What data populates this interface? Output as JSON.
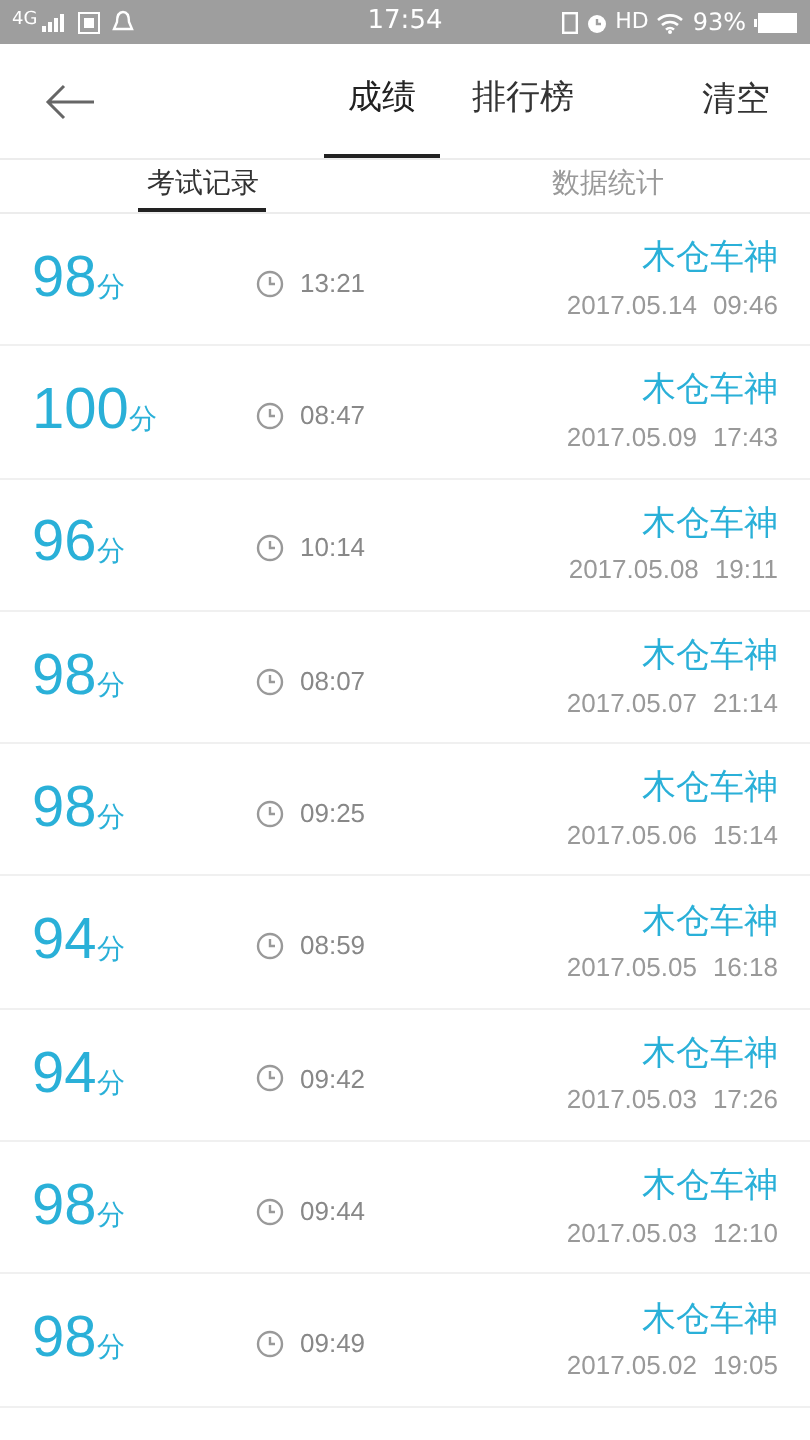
{
  "status_bar": {
    "network": "4G",
    "time": "17:54",
    "hd": "HD",
    "battery": "93%"
  },
  "header": {
    "tabs": [
      {
        "label": "成绩",
        "selected": true
      },
      {
        "label": "排行榜",
        "selected": false
      }
    ],
    "action": "清空"
  },
  "sub_tabs": [
    {
      "label": "考试记录",
      "selected": true
    },
    {
      "label": "数据统计",
      "selected": false
    }
  ],
  "records": [
    {
      "score": "98",
      "unit": "分",
      "duration": "13:21",
      "name": "木仓车神",
      "date": "2017.05.14",
      "time": "09:46"
    },
    {
      "score": "100",
      "unit": "分",
      "duration": "08:47",
      "name": "木仓车神",
      "date": "2017.05.09",
      "time": "17:43"
    },
    {
      "score": "96",
      "unit": "分",
      "duration": "10:14",
      "name": "木仓车神",
      "date": "2017.05.08",
      "time": "19:11"
    },
    {
      "score": "98",
      "unit": "分",
      "duration": "08:07",
      "name": "木仓车神",
      "date": "2017.05.07",
      "time": "21:14"
    },
    {
      "score": "98",
      "unit": "分",
      "duration": "09:25",
      "name": "木仓车神",
      "date": "2017.05.06",
      "time": "15:14"
    },
    {
      "score": "94",
      "unit": "分",
      "duration": "08:59",
      "name": "木仓车神",
      "date": "2017.05.05",
      "time": "16:18"
    },
    {
      "score": "94",
      "unit": "分",
      "duration": "09:42",
      "name": "木仓车神",
      "date": "2017.05.03",
      "time": "17:26"
    },
    {
      "score": "98",
      "unit": "分",
      "duration": "09:44",
      "name": "木仓车神",
      "date": "2017.05.03",
      "time": "12:10"
    },
    {
      "score": "98",
      "unit": "分",
      "duration": "09:49",
      "name": "木仓车神",
      "date": "2017.05.02",
      "time": "19:05"
    }
  ]
}
